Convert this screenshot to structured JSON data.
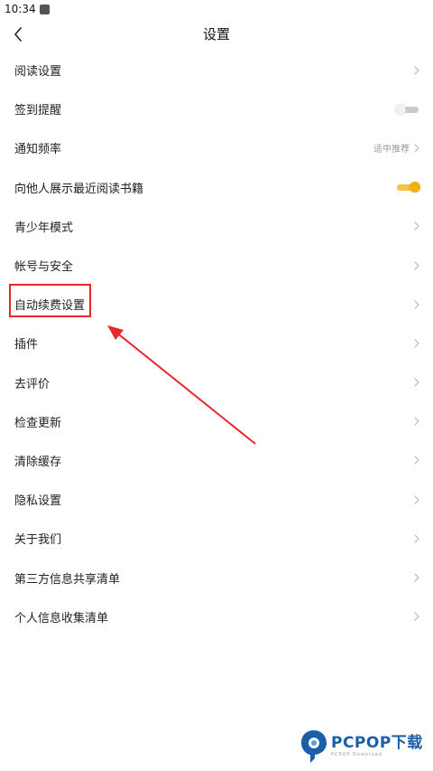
{
  "status_bar": {
    "time": "10:34"
  },
  "header": {
    "title": "设置"
  },
  "settings": [
    {
      "label": "阅读设置",
      "control": "chevron"
    },
    {
      "label": "签到提醒",
      "control": "toggle",
      "on": false
    },
    {
      "label": "通知频率",
      "control": "chevron",
      "value": "适中推荐"
    },
    {
      "label": "向他人展示最近阅读书籍",
      "control": "toggle",
      "on": true
    },
    {
      "label": "青少年模式",
      "control": "chevron"
    },
    {
      "label": "帐号与安全",
      "control": "chevron"
    },
    {
      "label": "自动续费设置",
      "control": "chevron"
    },
    {
      "label": "插件",
      "control": "chevron"
    },
    {
      "label": "去评价",
      "control": "chevron"
    },
    {
      "label": "检查更新",
      "control": "chevron"
    },
    {
      "label": "清除缓存",
      "control": "chevron"
    },
    {
      "label": "隐私设置",
      "control": "chevron"
    },
    {
      "label": "关于我们",
      "control": "chevron"
    },
    {
      "label": "第三方信息共享清单",
      "control": "chevron"
    },
    {
      "label": "个人信息收集清单",
      "control": "chevron"
    }
  ],
  "colors": {
    "annotation": "#e8262b",
    "toggle_on": "#f3b110",
    "toggle_off": "#c9c9c9",
    "watermark_blue": "#1a5fa8"
  },
  "watermark": {
    "brand": "PCPOP下载",
    "sub": "PCPOP Download",
    "icon": "pcpop-logo-icon"
  }
}
